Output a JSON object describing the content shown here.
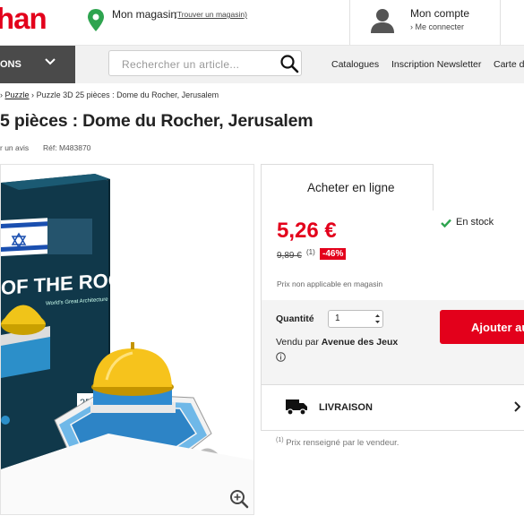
{
  "header": {
    "logo_text": "han",
    "store_title": "Mon magasin",
    "store_link": "(Trouver un magasin)",
    "account_title": "Mon compte",
    "account_sub": "› Me connecter"
  },
  "nav": {
    "menu_label": "ONS",
    "search_placeholder": "Rechercher un article...",
    "links": [
      "Catalogues",
      "Inscription Newsletter",
      "Carte d"
    ]
  },
  "breadcrumb": {
    "sep1": "›",
    "item1": "Puzzle",
    "sep2": "›",
    "current": "Puzzle 3D 25 pièces : Dome du Rocher, Jerusalem"
  },
  "product": {
    "title": "5 pièces : Dome du Rocher, Jerusalem",
    "reviews": "r un avis",
    "ref": "Réf:  M483870",
    "box_text": "OF THE ROCK",
    "box_sub": "World's Great Architecture",
    "box_count": "25"
  },
  "buy": {
    "tab_label": "Acheter en ligne",
    "price": "5,26 €",
    "old_price": "9,89 €",
    "old_note": "(1)",
    "discount": "-46%",
    "stock": "En stock",
    "store_note": "Prix non applicable en magasin",
    "quantity_label": "Quantité",
    "quantity_value": "1",
    "sold_by_prefix": "Vendu par ",
    "seller": "Avenue des Jeux",
    "add_label": "Ajouter au",
    "delivery_label": "LIVRAISON",
    "footnote_mark": "(1)",
    "footnote": " Prix renseigné par le vendeur."
  },
  "colors": {
    "brand_red": "#e3001b",
    "stock_green": "#2ea44f"
  },
  "icons": [
    "map-pin-icon",
    "user-icon",
    "chevron-down-icon",
    "search-icon",
    "zoom-icon",
    "check-icon",
    "info-icon",
    "truck-icon",
    "chevron-right-icon"
  ]
}
